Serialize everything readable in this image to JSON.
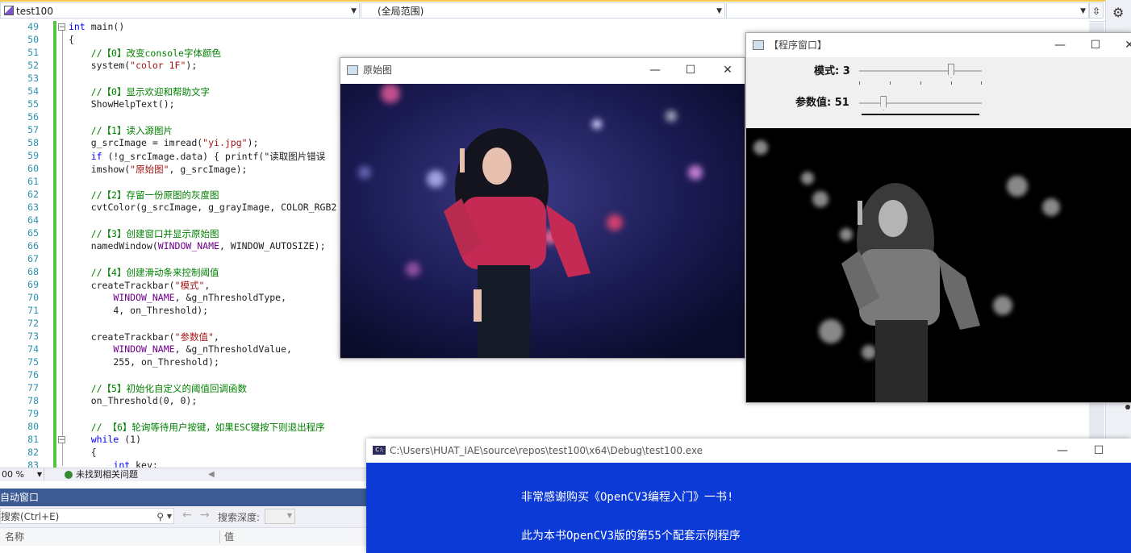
{
  "vs": {
    "project_combo": "test100",
    "scope_combo": "(全局范围)",
    "member_combo": "",
    "zoom": "00 %",
    "issues_status": "未找到相关问题",
    "autos_title": "自动窗口",
    "search_placeholder": "搜索(Ctrl+E)",
    "search_depth_label": "搜索深度:",
    "col_name": "名称",
    "col_value": "值"
  },
  "code": {
    "line_numbers": [
      "49",
      "50",
      "51",
      "52",
      "53",
      "54",
      "55",
      "56",
      "57",
      "58",
      "59",
      "60",
      "61",
      "62",
      "63",
      "64",
      "65",
      "66",
      "67",
      "68",
      "69",
      "70",
      "71",
      "72",
      "73",
      "74",
      "75",
      "76",
      "77",
      "78",
      "79",
      "80",
      "81",
      "82",
      "83"
    ],
    "lines": [
      "int main()",
      "{",
      "    //【0】改变console字体颜色",
      "    system(\"color 1F\");",
      "",
      "    //【0】显示欢迎和帮助文字",
      "    ShowHelpText();",
      "",
      "    //【1】读入源图片",
      "    g_srcImage = imread(\"yi.jpg\");",
      "    if (!g_srcImage.data) { printf(\"读取图片错误",
      "    imshow(\"原始图\", g_srcImage);",
      "",
      "    //【2】存留一份原图的灰度图",
      "    cvtColor(g_srcImage, g_grayImage, COLOR_RGB2",
      "",
      "    //【3】创建窗口并显示原始图",
      "    namedWindow(WINDOW_NAME, WINDOW_AUTOSIZE);",
      "",
      "    //【4】创建滑动条来控制阈值",
      "    createTrackbar(\"模式\",",
      "        WINDOW_NAME, &g_nThresholdType,",
      "        4, on_Threshold);",
      "",
      "    createTrackbar(\"参数值\",",
      "        WINDOW_NAME, &g_nThresholdValue,",
      "        255, on_Threshold);",
      "",
      "    //【5】初始化自定义的阈值回调函数",
      "    on_Threshold(0, 0);",
      "",
      "    // 【6】轮询等待用户按键，如果ESC键按下则退出程序",
      "    while (1)",
      "    {",
      "        int key;"
    ]
  },
  "orig_window": {
    "title": "原始图"
  },
  "prog_window": {
    "title": "【程序窗口】",
    "mode_label": "模式: 3",
    "param_label": "参数值: 51",
    "mode_value": 3,
    "mode_max": 4,
    "param_value": 51,
    "param_max": 255
  },
  "console": {
    "title": "C:\\Users\\HUAT_IAE\\source\\repos\\test100\\x64\\Debug\\test100.exe",
    "line1": "非常感谢购买《OpenCV3编程入门》一书!",
    "line2": "此为本书OpenCV3版的第55个配套示例程序"
  },
  "colors": {
    "console_bg": "#0c3ad6",
    "autos_title_bg": "#3c5a93",
    "change_bar": "#57c443"
  },
  "icons": {
    "gear": "gear-icon",
    "minimize": "minimize-icon",
    "maximize": "maximize-icon",
    "close": "close-icon"
  }
}
